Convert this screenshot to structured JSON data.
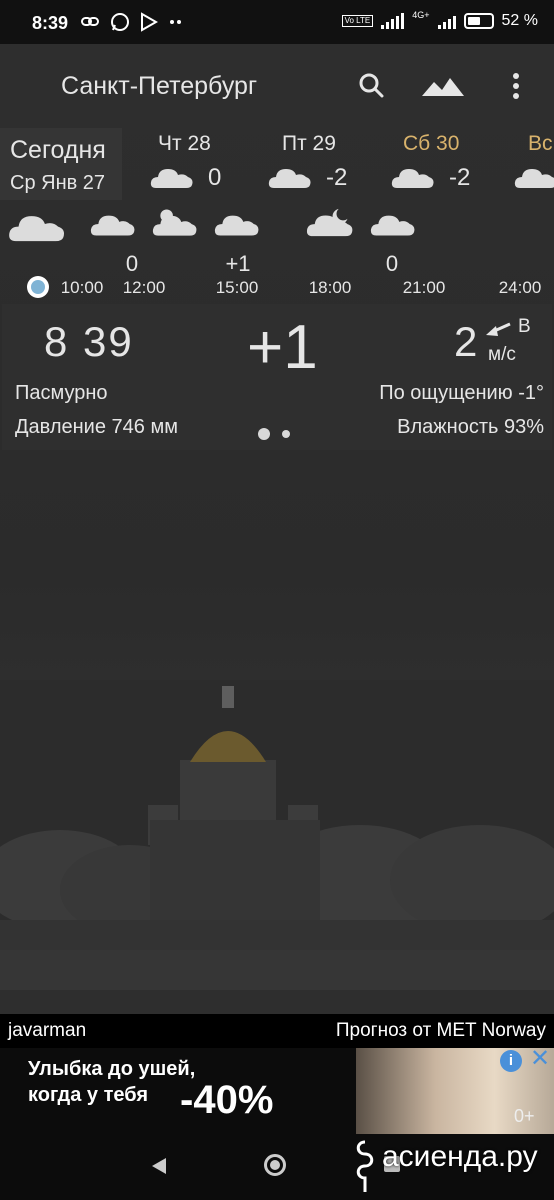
{
  "status_bar": {
    "time": "8:39",
    "battery_percent": "52 %",
    "network": "4G+",
    "volte": "Vo LTE"
  },
  "app_bar": {
    "city": "Санкт-Петербург",
    "icons": [
      "search-icon",
      "landscape-icon",
      "more-vert-icon"
    ]
  },
  "days": {
    "today": {
      "label": "Сегодня",
      "date": "Ср Янв 27"
    },
    "items": [
      {
        "label": "Чт 28",
        "temp": "0",
        "icon": "cloud-icon",
        "highlight": false
      },
      {
        "label": "Пт 29",
        "temp": "-2",
        "icon": "cloud-icon",
        "highlight": false
      },
      {
        "label": "Сб 30",
        "temp": "-2",
        "icon": "cloud-icon",
        "highlight": true
      },
      {
        "label": "Вс",
        "temp": "",
        "icon": "cloud-icon",
        "highlight": true
      }
    ]
  },
  "hourly": {
    "temps": [
      "0",
      "+1",
      "0"
    ],
    "times": [
      "10:00",
      "12:00",
      "15:00",
      "18:00",
      "21:00",
      "24:00"
    ]
  },
  "current": {
    "clock": "8  39",
    "temp": "+1",
    "wind_speed": "2",
    "wind_dir": "В",
    "wind_unit": "м/с",
    "condition": "Пасмурно",
    "pressure": "Давление 746 мм",
    "feels_like": "По ощущению -1°",
    "humidity": "Влажность 93%"
  },
  "credits": {
    "author": "javarman",
    "source": "Прогноз от MET Norway"
  },
  "ad": {
    "line1": "Улыбка до ушей,",
    "line2": "когда у тебя",
    "discount": "-40%",
    "age": "0+"
  },
  "watermark": "асиенда.ру",
  "colors": {
    "highlight": "#d9b36c",
    "background": "#2b2b2b",
    "text": "#e6e6e6",
    "now_dot": "#7fb3d5"
  }
}
